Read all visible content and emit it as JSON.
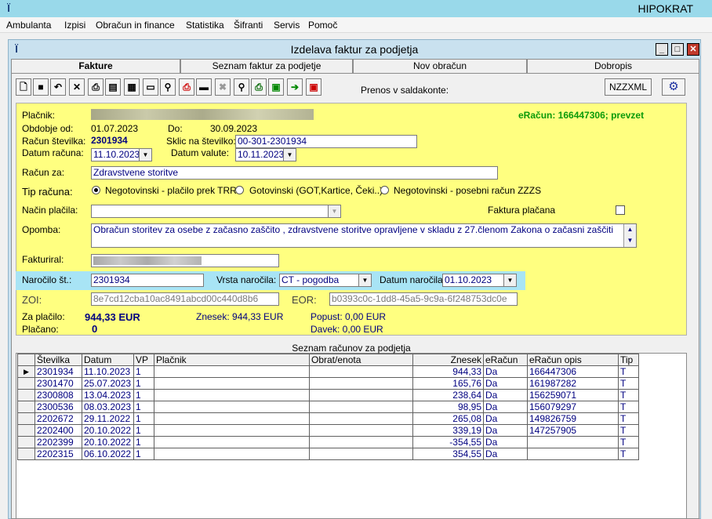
{
  "app": {
    "title": "HIPOKRAT"
  },
  "menu": [
    "Ambulanta",
    "Izpisi",
    "Obračun in finance",
    "Statistika",
    "Šifranti",
    "Servis",
    "Pomoč"
  ],
  "window": {
    "title": "Izdelava faktur za podjetja",
    "min": "_",
    "max": "□",
    "close": "✕"
  },
  "tabs": [
    "Fakture",
    "Seznam faktur za podjetje",
    "Nov obračun",
    "Dobropis"
  ],
  "toolbar": {
    "prenos_label": "Prenos v saldakonte:",
    "nzzxml": "NZZXML"
  },
  "form": {
    "placnik_label": "Plačnik:",
    "eracun_status": "eRačun: 166447306; prevzet",
    "obdobje_label": "Obdobje od:",
    "obdobje_od": "01.07.2023",
    "do_label": "Do:",
    "obdobje_do": "30.09.2023",
    "racun_stevilka_label": "Račun številka:",
    "racun_stevilka": "2301934",
    "sklic_label": "Sklic na številko:",
    "sklic": "00-301-2301934",
    "datum_racuna_label": "Datum računa:",
    "datum_racuna": "11.10.2023",
    "datum_valute_label": "Datum valute:",
    "datum_valute": "10.11.2023",
    "racun_za_label": "Račun za:",
    "racun_za": "Zdravstvene storitve",
    "tip_racuna_label": "Tip računa:",
    "tip_options": [
      "Negotovinski - plačilo prek TRR",
      "Gotovinski (GOT,Kartice, Čeki..)",
      "Negotovinski - posebni račun ZZZS"
    ],
    "nacin_placila_label": "Način plačila:",
    "faktura_placana_label": "Faktura plačana",
    "opomba_label": "Opomba:",
    "opomba": "Obračun storitev za osebe z začasno zaščito , zdravstvene storitve opravljene v skladu z 27.členom Zakona o začasni zaščiti razseljenih oseb.",
    "fakturiral_label": "Fakturiral:",
    "narocilo_label": "Naročilo št.:",
    "narocilo": "2301934",
    "vrsta_narocila_label": "Vrsta naročila:",
    "vrsta_narocila": "CT - pogodba",
    "datum_narocila_label": "Datum naročila:",
    "datum_narocila": "01.10.2023",
    "zoi_label": "ZOI:",
    "zoi": "8e7cd12cba10ac8491abcd00c440d8b6",
    "eor_label": "EOR:",
    "eor": "b0393c0c-1dd8-45a5-9c9a-6f248753dc0e",
    "za_placilo_label": "Za plačilo:",
    "za_placilo": "944,33 EUR",
    "znesek_text": "Znesek: 944,33 EUR",
    "popust_text": "Popust: 0,00 EUR",
    "davek_text": "Davek: 0,00 EUR",
    "placano_label": "Plačano:",
    "placano": "0"
  },
  "grid": {
    "caption": "Seznam računov za podjetja",
    "columns": [
      "Številka",
      "Datum",
      "VP",
      "Plačnik",
      "Obrat/enota",
      "Znesek",
      "eRačun",
      "eRačun opis",
      "Tip"
    ],
    "rows": [
      [
        "2301934",
        "11.10.2023",
        "1",
        "",
        "",
        "944,33",
        "Da",
        "166447306",
        "T"
      ],
      [
        "2301470",
        "25.07.2023",
        "1",
        "",
        "",
        "165,76",
        "Da",
        "161987282",
        "T"
      ],
      [
        "2300808",
        "13.04.2023",
        "1",
        "",
        "",
        "238,64",
        "Da",
        "156259071",
        "T"
      ],
      [
        "2300536",
        "08.03.2023",
        "1",
        "",
        "",
        "98,95",
        "Da",
        "156079297",
        "T"
      ],
      [
        "2202672",
        "29.11.2022",
        "1",
        "",
        "",
        "265,08",
        "Da",
        "149826759",
        "T"
      ],
      [
        "2202400",
        "20.10.2022",
        "1",
        "",
        "",
        "339,19",
        "Da",
        "147257905",
        "T"
      ],
      [
        "2202399",
        "20.10.2022",
        "1",
        "",
        "",
        "-354,55",
        "Da",
        "",
        "T"
      ],
      [
        "2202315",
        "06.10.2022",
        "1",
        "",
        "",
        "354,55",
        "Da",
        "",
        "T"
      ]
    ]
  }
}
